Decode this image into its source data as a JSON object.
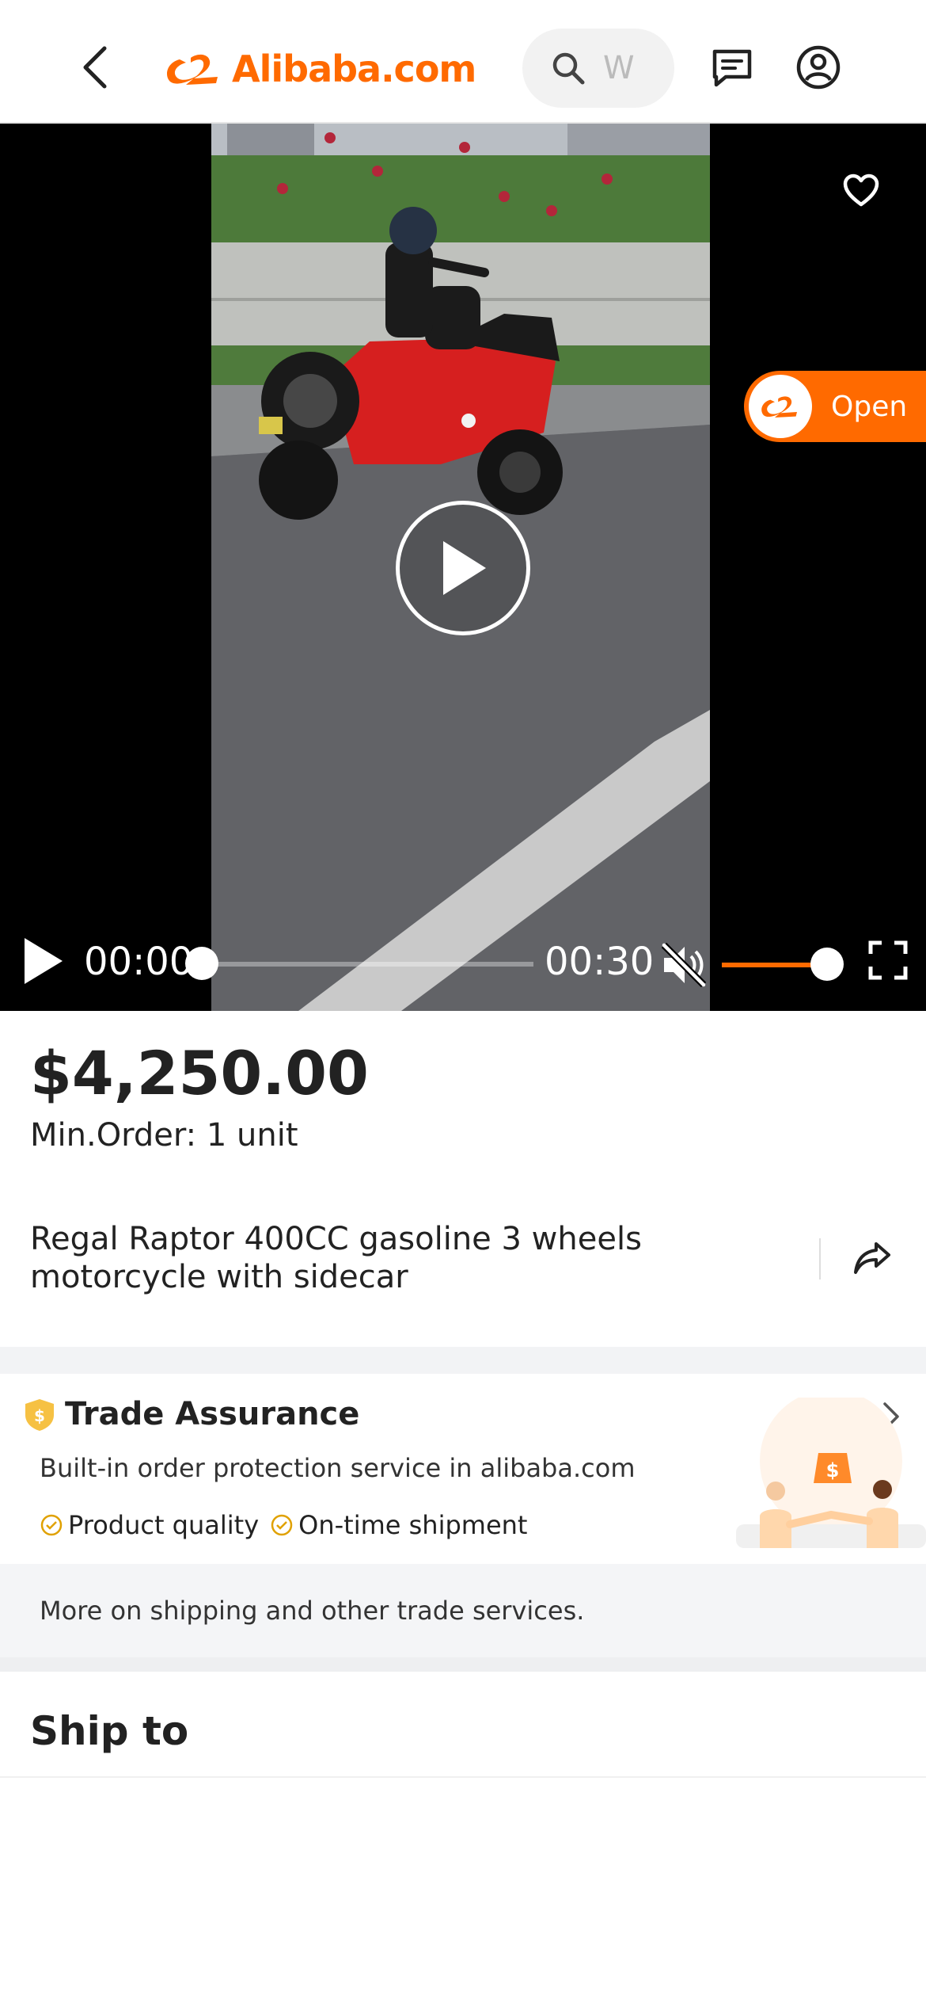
{
  "header": {
    "logo_text": "Alibaba.com",
    "search_placeholder": "W",
    "accent_color": "#ff6a00"
  },
  "video": {
    "open_label": "Open",
    "current_time": "00:00",
    "duration": "00:30",
    "progress": 0,
    "volume": 1.0,
    "muted": true
  },
  "product": {
    "price": "$4,250.00",
    "min_order": "Min.Order: 1 unit",
    "title": "Regal Raptor 400CC gasoline 3 wheels motorcycle with sidecar"
  },
  "trade_assurance": {
    "title": "Trade Assurance",
    "subtitle": "Built-in order protection service in alibaba.com",
    "features": [
      "Product quality",
      "On-time shipment"
    ],
    "more_text": "More on shipping and other trade services."
  },
  "shipping": {
    "title": "Ship to"
  }
}
